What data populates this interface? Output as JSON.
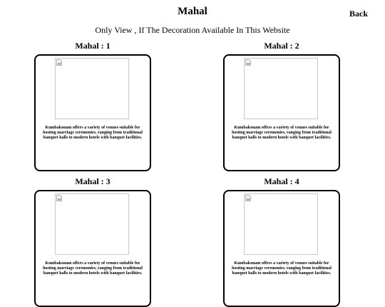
{
  "page": {
    "title": "Mahal",
    "back_label": "Back",
    "subtitle": "Only View , If The Decoration Available In This Website"
  },
  "mahals": [
    {
      "heading": "Mahal : 1",
      "description": "Kumbakonam offers a variety of venues suitable for hosting marriage ceremonies, ranging from traditional banquet halls to modern hotels with banquet facilities."
    },
    {
      "heading": "Mahal : 2",
      "description": "Kumbakonam offers a variety of venues suitable for hosting marriage ceremonies, ranging from traditional banquet halls to modern hotels with banquet facilities."
    },
    {
      "heading": "Mahal : 3",
      "description": "Kumbakonam offers a variety of venues suitable for hosting marriage ceremonies, ranging from traditional banquet halls to modern hotels with banquet facilities."
    },
    {
      "heading": "Mahal : 4",
      "description": "Kumbakonam offers a variety of venues suitable for hosting marriage ceremonies, ranging from traditional banquet halls to modern hotels with banquet facilities."
    }
  ],
  "icons": {
    "image_placeholder": "broken-image-icon"
  },
  "colors": {
    "text": "#000000",
    "card_border": "#000000",
    "image_border": "#c8c8c8",
    "background": "#ffffff"
  }
}
